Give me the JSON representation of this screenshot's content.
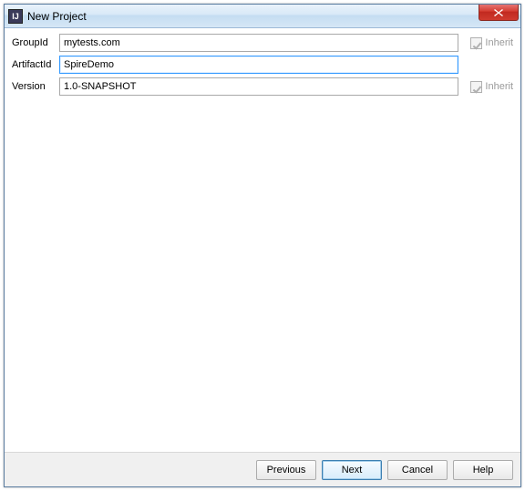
{
  "window": {
    "title": "New Project"
  },
  "form": {
    "groupId": {
      "label": "GroupId",
      "value": "mytests.com",
      "inherit": "Inherit"
    },
    "artifactId": {
      "label": "ArtifactId",
      "value": "SpireDemo"
    },
    "version": {
      "label": "Version",
      "value": "1.0-SNAPSHOT",
      "inherit": "Inherit"
    }
  },
  "buttons": {
    "previous": "Previous",
    "next": "Next",
    "cancel": "Cancel",
    "help": "Help"
  }
}
